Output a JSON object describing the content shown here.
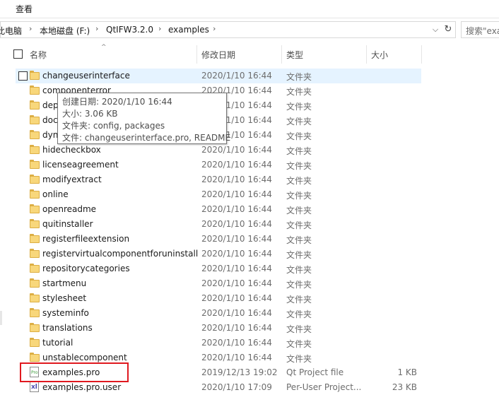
{
  "ribbon": {
    "tab_view": "查看"
  },
  "address": {
    "crumbs": [
      "此电脑",
      "本地磁盘 (F:)",
      "QtIFW3.2.0",
      "examples"
    ],
    "separator": "›",
    "dropdown": "⌵",
    "refresh": "↻",
    "search_placeholder": "搜索\"examples\""
  },
  "columns": {
    "name": "名称",
    "date": "修改日期",
    "type": "类型",
    "size": "大小",
    "sort_indicator": "^"
  },
  "rows": [
    {
      "name": "changeuserinterface",
      "date": "2020/1/10 16:44",
      "type": "文件夹",
      "size": "",
      "icon": "folder-icon"
    },
    {
      "name": "componenterror",
      "date": "2020/1/10 16:44",
      "type": "文件夹",
      "size": "",
      "icon": "folder-icon"
    },
    {
      "name": "dependencies",
      "date": "2020/1/10 16:44",
      "type": "文件夹",
      "size": "",
      "icon": "folder-icon"
    },
    {
      "name": "dochecks",
      "date": "2020/1/10 16:44",
      "type": "文件夹",
      "size": "",
      "icon": "folder-icon"
    },
    {
      "name": "dynamicpage",
      "date": "2020/1/10 16:44",
      "type": "文件夹",
      "size": "",
      "icon": "folder-icon"
    },
    {
      "name": "hidecheckbox",
      "date": "2020/1/10 16:44",
      "type": "文件夹",
      "size": "",
      "icon": "folder-icon"
    },
    {
      "name": "licenseagreement",
      "date": "2020/1/10 16:44",
      "type": "文件夹",
      "size": "",
      "icon": "folder-icon"
    },
    {
      "name": "modifyextract",
      "date": "2020/1/10 16:44",
      "type": "文件夹",
      "size": "",
      "icon": "folder-icon"
    },
    {
      "name": "online",
      "date": "2020/1/10 16:44",
      "type": "文件夹",
      "size": "",
      "icon": "folder-icon"
    },
    {
      "name": "openreadme",
      "date": "2020/1/10 16:44",
      "type": "文件夹",
      "size": "",
      "icon": "folder-icon"
    },
    {
      "name": "quitinstaller",
      "date": "2020/1/10 16:44",
      "type": "文件夹",
      "size": "",
      "icon": "folder-icon"
    },
    {
      "name": "registerfileextension",
      "date": "2020/1/10 16:44",
      "type": "文件夹",
      "size": "",
      "icon": "folder-icon"
    },
    {
      "name": "registervirtualcomponentforuninstall",
      "date": "2020/1/10 16:44",
      "type": "文件夹",
      "size": "",
      "icon": "folder-icon"
    },
    {
      "name": "repositorycategories",
      "date": "2020/1/10 16:44",
      "type": "文件夹",
      "size": "",
      "icon": "folder-icon"
    },
    {
      "name": "startmenu",
      "date": "2020/1/10 16:44",
      "type": "文件夹",
      "size": "",
      "icon": "folder-icon"
    },
    {
      "name": "stylesheet",
      "date": "2020/1/10 16:44",
      "type": "文件夹",
      "size": "",
      "icon": "folder-icon"
    },
    {
      "name": "systeminfo",
      "date": "2020/1/10 16:44",
      "type": "文件夹",
      "size": "",
      "icon": "folder-icon"
    },
    {
      "name": "translations",
      "date": "2020/1/10 16:44",
      "type": "文件夹",
      "size": "",
      "icon": "folder-icon"
    },
    {
      "name": "tutorial",
      "date": "2020/1/10 16:44",
      "type": "文件夹",
      "size": "",
      "icon": "folder-icon"
    },
    {
      "name": "unstablecomponent",
      "date": "2020/1/10 16:44",
      "type": "文件夹",
      "size": "",
      "icon": "folder-icon"
    },
    {
      "name": "examples.pro",
      "date": "2019/12/13 19:02",
      "type": "Qt Project file",
      "size": "1 KB",
      "icon": "qt-project-file-icon"
    },
    {
      "name": "examples.pro.user",
      "date": "2020/1/10 17:09",
      "type": "Per-User Project...",
      "size": "23 KB",
      "icon": "user-project-file-icon"
    }
  ],
  "tooltip": {
    "created": "创建日期: 2020/1/10 16:44",
    "size": "大小: 3.06 KB",
    "folders": "文件夹: config, packages",
    "files": "文件: changeuserinterface.pro, README"
  },
  "icons": {
    "qt_label": "Pro",
    "user_label": "xl"
  },
  "colors": {
    "selection": "#e5f3ff",
    "highlight": "#e0191f",
    "folder": "#f8d77b"
  }
}
